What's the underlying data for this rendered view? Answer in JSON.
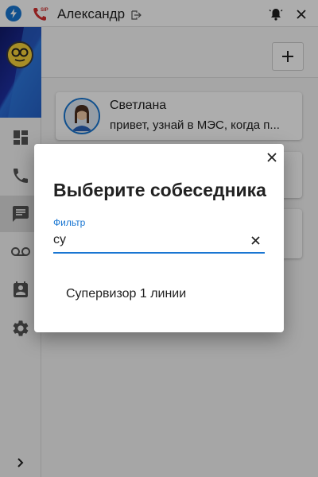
{
  "window": {
    "user_name": "Александр",
    "sip_badge": "SIP"
  },
  "main": {
    "chats": [
      {
        "name": "Светлана",
        "preview": "привет, узнай в МЭС, когда п..."
      },
      {
        "name": "",
        "preview": ""
      },
      {
        "name": "",
        "preview": ""
      }
    ]
  },
  "dialog": {
    "title": "Выберите собеседника",
    "filter_label": "Фильтр",
    "filter_value": "су",
    "results": [
      "Супервизор 1 линии"
    ]
  },
  "colors": {
    "accent": "#1976d2",
    "missed_call": "#d32f2f",
    "sidebar_brand_dark": "#111a6b",
    "sidebar_brand_light": "#2b6ed8"
  },
  "icons": {
    "titlebar": [
      "lightning-icon",
      "sip-phone-icon",
      "logout-icon",
      "bell-icon",
      "close-icon"
    ],
    "sidebar": [
      "dashboard-icon",
      "phone-icon",
      "chat-icon",
      "voicemail-icon",
      "contacts-icon",
      "settings-icon",
      "chevron-right-icon"
    ]
  }
}
